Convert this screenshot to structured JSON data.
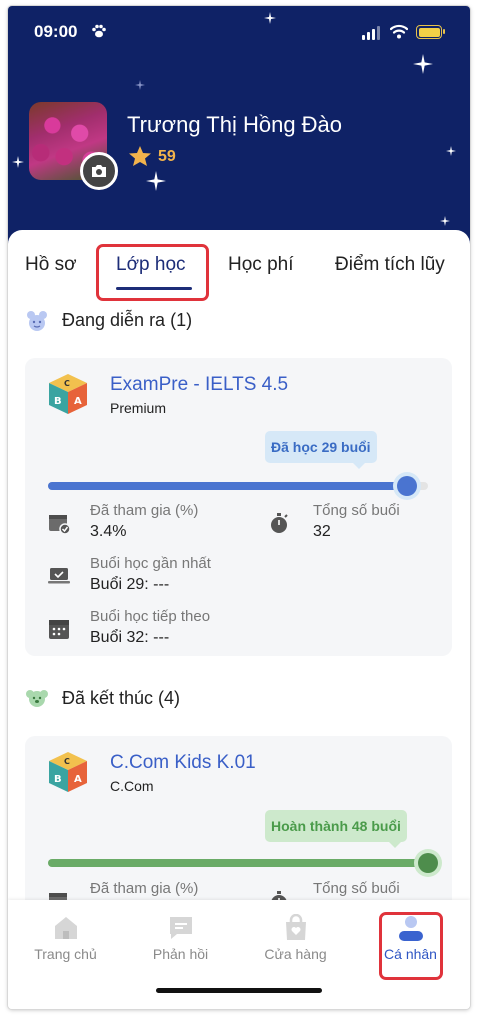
{
  "status_bar": {
    "time": "09:00"
  },
  "profile": {
    "name": "Trương Thị Hồng Đào",
    "points": "59"
  },
  "tabs": [
    {
      "label": "Hồ sơ"
    },
    {
      "label": "Lớp học"
    },
    {
      "label": "Học phí"
    },
    {
      "label": "Điểm tích lũy"
    }
  ],
  "active_tab": "Lớp học",
  "sections": {
    "ongoing": {
      "title": "Đang diễn ra (1)",
      "course": {
        "title": "ExamPre - IELTS 4.5",
        "subtitle": "Premium",
        "progress_label": "Đã học 29 buổi",
        "progress_fraction": 0.944,
        "stats": {
          "attended_label": "Đã tham gia (%)",
          "attended_value": "3.4%",
          "total_label": "Tổng số buổi",
          "total_value": "32",
          "latest_label": "Buổi học gần nhất",
          "latest_value": "Buổi 29: ---",
          "next_label": "Buổi học tiếp theo",
          "next_value": "Buổi 32: ---"
        }
      }
    },
    "finished": {
      "title": "Đã kết thúc (4)",
      "course": {
        "title": "C.Com Kids K.01",
        "subtitle": "C.Com",
        "progress_label": "Hoàn thành 48 buổi",
        "progress_fraction": 1.0,
        "stats": {
          "attended_label": "Đã tham gia (%)",
          "total_label": "Tổng số buổi"
        }
      }
    }
  },
  "bottom_nav": [
    {
      "label": "Trang chủ",
      "icon": "home-icon"
    },
    {
      "label": "Phản hồi",
      "icon": "chat-icon"
    },
    {
      "label": "Cửa hàng",
      "icon": "shop-bag-icon"
    },
    {
      "label": "Cá nhân",
      "icon": "user-icon"
    }
  ],
  "colors": {
    "header_bg": "#0f2266",
    "accent_blue": "#3a5fc7",
    "progress_blue": "#4a74d0",
    "progress_green": "#6aab67",
    "highlight_red": "#e0333b"
  }
}
